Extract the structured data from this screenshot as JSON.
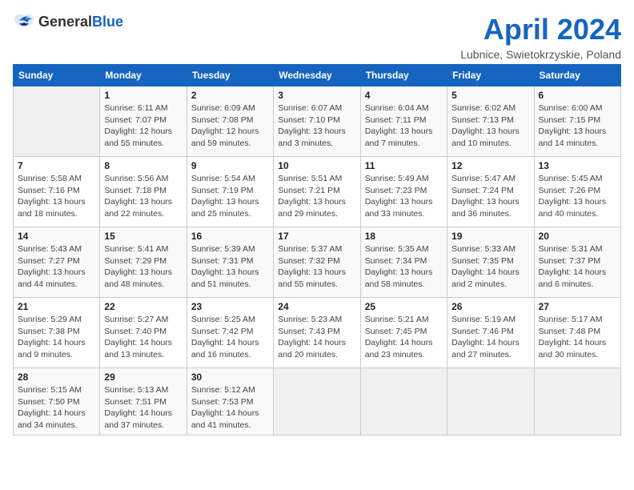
{
  "logo": {
    "general": "General",
    "blue": "Blue"
  },
  "title": "April 2024",
  "subtitle": "Lubnice, Swietokrzyskie, Poland",
  "weekdays": [
    "Sunday",
    "Monday",
    "Tuesday",
    "Wednesday",
    "Thursday",
    "Friday",
    "Saturday"
  ],
  "weeks": [
    [
      {
        "num": "",
        "info": ""
      },
      {
        "num": "1",
        "info": "Sunrise: 6:11 AM\nSunset: 7:07 PM\nDaylight: 12 hours\nand 55 minutes."
      },
      {
        "num": "2",
        "info": "Sunrise: 6:09 AM\nSunset: 7:08 PM\nDaylight: 12 hours\nand 59 minutes."
      },
      {
        "num": "3",
        "info": "Sunrise: 6:07 AM\nSunset: 7:10 PM\nDaylight: 13 hours\nand 3 minutes."
      },
      {
        "num": "4",
        "info": "Sunrise: 6:04 AM\nSunset: 7:11 PM\nDaylight: 13 hours\nand 7 minutes."
      },
      {
        "num": "5",
        "info": "Sunrise: 6:02 AM\nSunset: 7:13 PM\nDaylight: 13 hours\nand 10 minutes."
      },
      {
        "num": "6",
        "info": "Sunrise: 6:00 AM\nSunset: 7:15 PM\nDaylight: 13 hours\nand 14 minutes."
      }
    ],
    [
      {
        "num": "7",
        "info": "Sunrise: 5:58 AM\nSunset: 7:16 PM\nDaylight: 13 hours\nand 18 minutes."
      },
      {
        "num": "8",
        "info": "Sunrise: 5:56 AM\nSunset: 7:18 PM\nDaylight: 13 hours\nand 22 minutes."
      },
      {
        "num": "9",
        "info": "Sunrise: 5:54 AM\nSunset: 7:19 PM\nDaylight: 13 hours\nand 25 minutes."
      },
      {
        "num": "10",
        "info": "Sunrise: 5:51 AM\nSunset: 7:21 PM\nDaylight: 13 hours\nand 29 minutes."
      },
      {
        "num": "11",
        "info": "Sunrise: 5:49 AM\nSunset: 7:23 PM\nDaylight: 13 hours\nand 33 minutes."
      },
      {
        "num": "12",
        "info": "Sunrise: 5:47 AM\nSunset: 7:24 PM\nDaylight: 13 hours\nand 36 minutes."
      },
      {
        "num": "13",
        "info": "Sunrise: 5:45 AM\nSunset: 7:26 PM\nDaylight: 13 hours\nand 40 minutes."
      }
    ],
    [
      {
        "num": "14",
        "info": "Sunrise: 5:43 AM\nSunset: 7:27 PM\nDaylight: 13 hours\nand 44 minutes."
      },
      {
        "num": "15",
        "info": "Sunrise: 5:41 AM\nSunset: 7:29 PM\nDaylight: 13 hours\nand 48 minutes."
      },
      {
        "num": "16",
        "info": "Sunrise: 5:39 AM\nSunset: 7:31 PM\nDaylight: 13 hours\nand 51 minutes."
      },
      {
        "num": "17",
        "info": "Sunrise: 5:37 AM\nSunset: 7:32 PM\nDaylight: 13 hours\nand 55 minutes."
      },
      {
        "num": "18",
        "info": "Sunrise: 5:35 AM\nSunset: 7:34 PM\nDaylight: 13 hours\nand 58 minutes."
      },
      {
        "num": "19",
        "info": "Sunrise: 5:33 AM\nSunset: 7:35 PM\nDaylight: 14 hours\nand 2 minutes."
      },
      {
        "num": "20",
        "info": "Sunrise: 5:31 AM\nSunset: 7:37 PM\nDaylight: 14 hours\nand 6 minutes."
      }
    ],
    [
      {
        "num": "21",
        "info": "Sunrise: 5:29 AM\nSunset: 7:38 PM\nDaylight: 14 hours\nand 9 minutes."
      },
      {
        "num": "22",
        "info": "Sunrise: 5:27 AM\nSunset: 7:40 PM\nDaylight: 14 hours\nand 13 minutes."
      },
      {
        "num": "23",
        "info": "Sunrise: 5:25 AM\nSunset: 7:42 PM\nDaylight: 14 hours\nand 16 minutes."
      },
      {
        "num": "24",
        "info": "Sunrise: 5:23 AM\nSunset: 7:43 PM\nDaylight: 14 hours\nand 20 minutes."
      },
      {
        "num": "25",
        "info": "Sunrise: 5:21 AM\nSunset: 7:45 PM\nDaylight: 14 hours\nand 23 minutes."
      },
      {
        "num": "26",
        "info": "Sunrise: 5:19 AM\nSunset: 7:46 PM\nDaylight: 14 hours\nand 27 minutes."
      },
      {
        "num": "27",
        "info": "Sunrise: 5:17 AM\nSunset: 7:48 PM\nDaylight: 14 hours\nand 30 minutes."
      }
    ],
    [
      {
        "num": "28",
        "info": "Sunrise: 5:15 AM\nSunset: 7:50 PM\nDaylight: 14 hours\nand 34 minutes."
      },
      {
        "num": "29",
        "info": "Sunrise: 5:13 AM\nSunset: 7:51 PM\nDaylight: 14 hours\nand 37 minutes."
      },
      {
        "num": "30",
        "info": "Sunrise: 5:12 AM\nSunset: 7:53 PM\nDaylight: 14 hours\nand 41 minutes."
      },
      {
        "num": "",
        "info": ""
      },
      {
        "num": "",
        "info": ""
      },
      {
        "num": "",
        "info": ""
      },
      {
        "num": "",
        "info": ""
      }
    ]
  ]
}
